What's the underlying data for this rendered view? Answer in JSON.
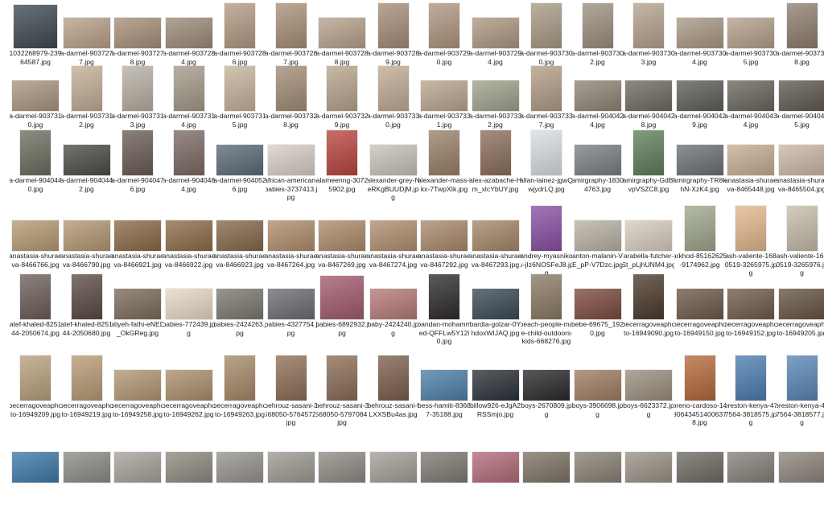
{
  "rows": [
    [
      {
        "name": "1032268979-23964587.jpg",
        "shape": "sq",
        "color": "#3f4a52"
      },
      {
        "name": "a-darmel-9037277.jpg",
        "shape": "land",
        "color": "#b9a089"
      },
      {
        "name": "a-darmel-9037278.jpg",
        "shape": "land",
        "color": "#a88f79"
      },
      {
        "name": "a-darmel-9037284.jpg",
        "shape": "land",
        "color": "#9c8a7a"
      },
      {
        "name": "a-darmel-9037286.jpg",
        "shape": "port",
        "color": "#b49a83"
      },
      {
        "name": "a-darmel-9037287.jpg",
        "shape": "port",
        "color": "#a89078"
      },
      {
        "name": "a-darmel-9037288.jpg",
        "shape": "land",
        "color": "#b7a28c"
      },
      {
        "name": "a-darmel-9037289.jpg",
        "shape": "port",
        "color": "#a58d77"
      },
      {
        "name": "a-darmel-9037290.jpg",
        "shape": "port",
        "color": "#b09680"
      },
      {
        "name": "a-darmel-9037294.jpg",
        "shape": "land",
        "color": "#ae9882"
      },
      {
        "name": "a-darmel-9037300.jpg",
        "shape": "port",
        "color": "#a99a86"
      },
      {
        "name": "a-darmel-9037302.jpg",
        "shape": "port",
        "color": "#9e8f7e"
      },
      {
        "name": "a-darmel-9037303.jpg",
        "shape": "port",
        "color": "#b5a38f"
      },
      {
        "name": "a-darmel-9037304.jpg",
        "shape": "land",
        "color": "#aa9884"
      },
      {
        "name": "a-darmel-9037305.jpg",
        "shape": "land",
        "color": "#b3a08b"
      },
      {
        "name": "a-darmel-9037308.jpg",
        "shape": "port",
        "color": "#8f7f6f"
      }
    ],
    [
      {
        "name": "a-darmel-9037310.jpg",
        "shape": "land",
        "color": "#a9967f"
      },
      {
        "name": "a-darmel-9037312.jpg",
        "shape": "port",
        "color": "#c2ae95"
      },
      {
        "name": "a-darmel-9037313.jpg",
        "shape": "port",
        "color": "#b7b0a4"
      },
      {
        "name": "a-darmel-9037314.jpg",
        "shape": "port",
        "color": "#a59a8b"
      },
      {
        "name": "a-darmel-9037315.jpg",
        "shape": "port",
        "color": "#c6b39c"
      },
      {
        "name": "a-darmel-9037328.jpg",
        "shape": "port",
        "color": "#a38c76"
      },
      {
        "name": "a-darmel-9037329.jpg",
        "shape": "port",
        "color": "#b8a48d"
      },
      {
        "name": "a-darmel-9037330.jpg",
        "shape": "port",
        "color": "#c0ab93"
      },
      {
        "name": "a-darmel-9037331.jpg",
        "shape": "land",
        "color": "#b9a58e"
      },
      {
        "name": "a-darmel-9037332.jpg",
        "shape": "land",
        "color": "#9fa28c"
      },
      {
        "name": "a-darmel-9037337.jpg",
        "shape": "port",
        "color": "#b29d86"
      },
      {
        "name": "a-darmel-9040424.jpg",
        "shape": "land",
        "color": "#8f8576"
      },
      {
        "name": "a-darmel-9040428.jpg",
        "shape": "land",
        "color": "#6f6a60"
      },
      {
        "name": "a-darmel-9040429.jpg",
        "shape": "land",
        "color": "#5d5e55"
      },
      {
        "name": "a-darmel-9040434.jpg",
        "shape": "land",
        "color": "#6a665c"
      },
      {
        "name": "a-darmel-9040435.jpg",
        "shape": "land",
        "color": "#5f5a51"
      }
    ],
    [
      {
        "name": "a-darmel-9040440.jpg",
        "shape": "port",
        "color": "#6b6e5f"
      },
      {
        "name": "a-darmel-9040442.jpg",
        "shape": "land",
        "color": "#4d4b46"
      },
      {
        "name": "a-darmel-9040476.jpg",
        "shape": "port",
        "color": "#6a5c55"
      },
      {
        "name": "a-darmel-9040484.jpg",
        "shape": "port",
        "color": "#7c6a63"
      },
      {
        "name": "a-darmel-9040526.jpg",
        "shape": "land",
        "color": "#5d6a7a"
      },
      {
        "name": "african-american-babies-3737413.jpg",
        "shape": "land",
        "color": "#d8cfc6"
      },
      {
        "name": "alameenng-30725902.jpg",
        "shape": "port",
        "color": "#b9453f"
      },
      {
        "name": "alexander-grey-NeRKgBUUDjM.jpg",
        "shape": "land",
        "color": "#c8c2b8"
      },
      {
        "name": "alexander-mass-ikx-7TwpXIk.jpg",
        "shape": "port",
        "color": "#9a8069"
      },
      {
        "name": "alex-azabache-Hm_xlcYbUY.jpg",
        "shape": "port",
        "color": "#8c6e5a"
      },
      {
        "name": "allan-lainez-jgwQwjydrLQ.jpg",
        "shape": "port",
        "color": "#d9dde2"
      },
      {
        "name": "amirgraphy-18304763.jpg",
        "shape": "land",
        "color": "#7a7e84"
      },
      {
        "name": "amirgraphy-GdBlvpVSZC8.jpg",
        "shape": "port",
        "color": "#5f7e5a"
      },
      {
        "name": "amirgraphy-TR8khN-XzK4.jpg",
        "shape": "land",
        "color": "#6c7076"
      },
      {
        "name": "anastasia-shuraeva-8465448.jpg",
        "shape": "land",
        "color": "#c7ad94"
      },
      {
        "name": "anastasia-shuraeva-8465504.jpg",
        "shape": "land",
        "color": "#cbb8a6"
      }
    ],
    [
      {
        "name": "anastasia-shuraeva-8466766.jpg",
        "shape": "land",
        "color": "#b59a72"
      },
      {
        "name": "anastasia-shuraeva-8466790.jpg",
        "shape": "land",
        "color": "#b29873"
      },
      {
        "name": "anastasia-shuraeva-8466921.jpg",
        "shape": "land",
        "color": "#8a6a47"
      },
      {
        "name": "anastasia-shuraeva-8466922.jpg",
        "shape": "land",
        "color": "#8d6c49"
      },
      {
        "name": "anastasia-shuraeva-8466923.jpg",
        "shape": "land",
        "color": "#86684a"
      },
      {
        "name": "anastasia-shuraeva-8467264.jpg",
        "shape": "land",
        "color": "#b08d6c"
      },
      {
        "name": "anastasia-shuraeva-8467269.jpg",
        "shape": "land",
        "color": "#ad8b6b"
      },
      {
        "name": "anastasia-shuraeva-8467274.jpg",
        "shape": "land",
        "color": "#b08f70"
      },
      {
        "name": "anastasia-shuraeva-8467292.jpg",
        "shape": "land",
        "color": "#a9896b"
      },
      {
        "name": "anastasia-shuraeva-8467293.jpg",
        "shape": "land",
        "color": "#a58768"
      },
      {
        "name": "andrey-myasnikov-jIz6NOSFeJ8.jpg",
        "shape": "port",
        "color": "#8a4fa3"
      },
      {
        "name": "anton-malanin-VE_pP-V7Dzc.jpg",
        "shape": "land",
        "color": "#b9b1a6"
      },
      {
        "name": "arabella-futcher-St_pLjhUNM4.jpg",
        "shape": "land",
        "color": "#d7cdc0"
      },
      {
        "name": "arkhod-85162625-9174962.jpg",
        "shape": "port",
        "color": "#9fa78b"
      },
      {
        "name": "ash-valiente-1680519-3265975.jpg",
        "shape": "port",
        "color": "#e3b88d"
      },
      {
        "name": "ash-valiente-1680519-3265976.jpg",
        "shape": "port",
        "color": "#c6bda9"
      }
    ],
    [
      {
        "name": "atef-khaled-825144-2050674.jpg",
        "shape": "port",
        "color": "#6d5e59"
      },
      {
        "name": "atef-khaled-825144-2050680.jpg",
        "shape": "port",
        "color": "#5b4b46"
      },
      {
        "name": "atiyeh-fathi-eNED_OkGReg.jpg",
        "shape": "land",
        "color": "#7c6b5b"
      },
      {
        "name": "babies-772439.jpg",
        "shape": "land",
        "color": "#e7d8c8"
      },
      {
        "name": "babies-2424263.jpg",
        "shape": "land",
        "color": "#7b786f"
      },
      {
        "name": "babies-4327754.jpg",
        "shape": "land",
        "color": "#6b6d74"
      },
      {
        "name": "babies-6892932.jpg",
        "shape": "sq",
        "color": "#a15b6e"
      },
      {
        "name": "baby-2424240.jpg",
        "shape": "land",
        "color": "#b57a78"
      },
      {
        "name": "bandan-mohammed-QFFLw5Y12i0.jpg",
        "shape": "port",
        "color": "#2f2b2e"
      },
      {
        "name": "bardia-golzar-0YhdoxWIJAQ.jpg",
        "shape": "land",
        "color": "#3b4a53"
      },
      {
        "name": "beach-people-male-child-outdoors-kids-668276.jpg",
        "shape": "port",
        "color": "#8a7a65"
      },
      {
        "name": "bebe-69675_1920.jpg",
        "shape": "land",
        "color": "#7d4a3c"
      },
      {
        "name": "becerragoveaphoto-16949090.jpg",
        "shape": "port",
        "color": "#4c3a2c"
      },
      {
        "name": "becerragoveaphoto-16949150.jpg",
        "shape": "land",
        "color": "#6c5947"
      },
      {
        "name": "becerragoveaphoto-16949152.jpg",
        "shape": "land",
        "color": "#6e5b48"
      },
      {
        "name": "becerragoveaphoto-16949205.jpg",
        "shape": "land",
        "color": "#655342"
      }
    ],
    [
      {
        "name": "becerragoveaphoto-16949209.jpg",
        "shape": "port",
        "color": "#b9a07d"
      },
      {
        "name": "becerragoveaphoto-16949219.jpg",
        "shape": "port",
        "color": "#b89b75"
      },
      {
        "name": "becerragoveaphoto-16949258.jpg",
        "shape": "land",
        "color": "#b29774"
      },
      {
        "name": "becerragoveaphoto-16949262.jpg",
        "shape": "land",
        "color": "#ad8f6c"
      },
      {
        "name": "becerragoveaphoto-16949263.jpg",
        "shape": "port",
        "color": "#a68a68"
      },
      {
        "name": "behrouz-sasani-3568050-5764572.jpg",
        "shape": "port",
        "color": "#8e6f57"
      },
      {
        "name": "behrouz-sasani-3568050-5797084.jpg",
        "shape": "port",
        "color": "#8b6d56"
      },
      {
        "name": "behrouz-sasani-fLXXSBu4as.jpg",
        "shape": "port",
        "color": "#7c5f4c"
      },
      {
        "name": "bess-hamiti-83687-35188.jpg",
        "shape": "land",
        "color": "#4d7fa8"
      },
      {
        "name": "billow926-eJgA2RSSmjo.jpg",
        "shape": "land",
        "color": "#2b3138"
      },
      {
        "name": "boys-2670809.jpg",
        "shape": "land",
        "color": "#2a2a2c"
      },
      {
        "name": "boys-3906698.jpg",
        "shape": "land",
        "color": "#9e7d63"
      },
      {
        "name": "boys-6623372.jpg",
        "shape": "land",
        "color": "#9a8f7e"
      },
      {
        "name": "breno-cardoso-14906434514006378.jpg",
        "shape": "port",
        "color": "#b46a3a"
      },
      {
        "name": "breston-kenya-477564-3818575.jpg",
        "shape": "port",
        "color": "#4e7db0"
      },
      {
        "name": "breston-kenya-477564-3818577.jpg",
        "shape": "port",
        "color": "#5a86b6"
      }
    ],
    [
      {
        "name": "",
        "shape": "land",
        "color": "#3f78a8"
      },
      {
        "name": "",
        "shape": "land",
        "color": "#8b8b86"
      },
      {
        "name": "",
        "shape": "land",
        "color": "#a6a29a"
      },
      {
        "name": "",
        "shape": "land",
        "color": "#8f8a80"
      },
      {
        "name": "",
        "shape": "land",
        "color": "#96938c"
      },
      {
        "name": "",
        "shape": "land",
        "color": "#9d9a92"
      },
      {
        "name": "",
        "shape": "land",
        "color": "#8f8b84"
      },
      {
        "name": "",
        "shape": "land",
        "color": "#a49f96"
      },
      {
        "name": "",
        "shape": "land",
        "color": "#7f7a71"
      },
      {
        "name": "",
        "shape": "land",
        "color": "#b26b7a"
      },
      {
        "name": "",
        "shape": "land",
        "color": "#7e7366"
      },
      {
        "name": "",
        "shape": "land",
        "color": "#8a8176"
      },
      {
        "name": "",
        "shape": "land",
        "color": "#9b9286"
      },
      {
        "name": "",
        "shape": "land",
        "color": "#6f6a62"
      },
      {
        "name": "",
        "shape": "land",
        "color": "#87807a"
      },
      {
        "name": "",
        "shape": "land",
        "color": "#8c857b"
      }
    ]
  ]
}
